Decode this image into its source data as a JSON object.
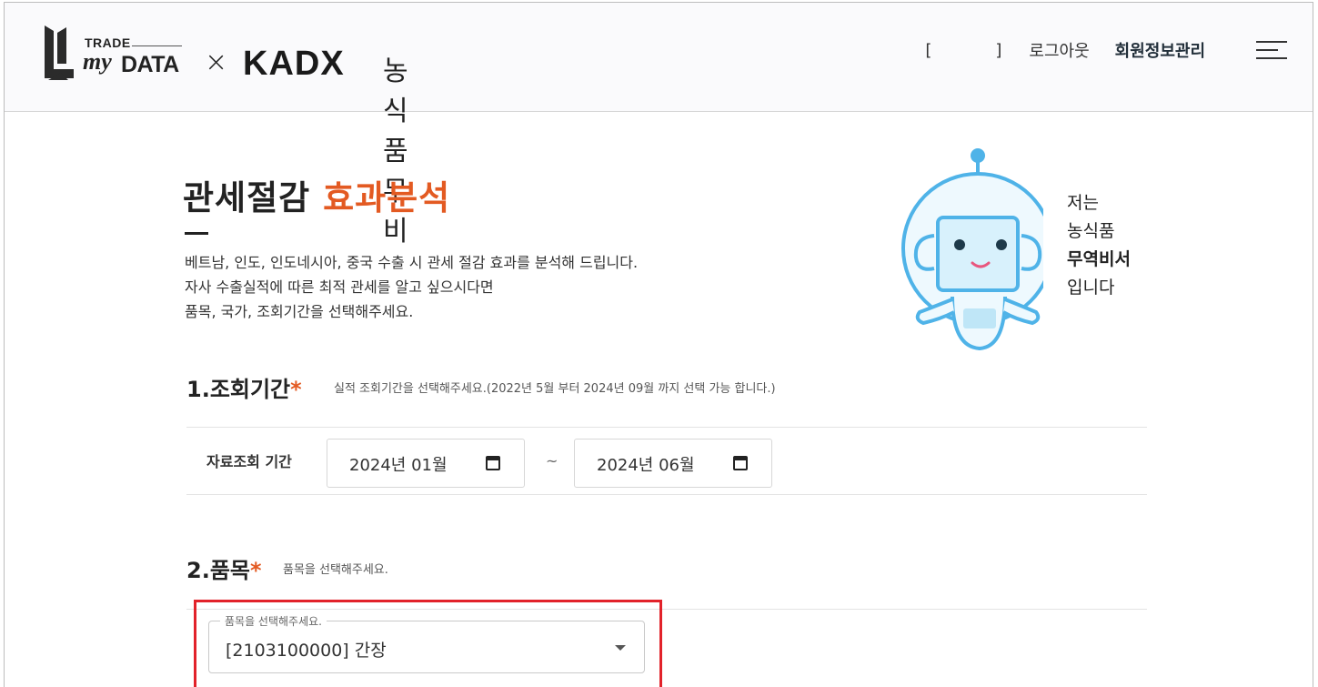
{
  "header": {
    "logo": {
      "trade": "TRADE",
      "my": "my",
      "data": "DATA",
      "x": "×",
      "kadx": "KADX",
      "korean": "농식품무비"
    },
    "nav": {
      "bracket_open": "[",
      "user_name": "",
      "bracket_close": "]",
      "logout": "로그아웃",
      "member_info": "회원정보관리"
    },
    "menu_icon": "hamburger-icon"
  },
  "main": {
    "title_plain": "관세절감",
    "title_accent": "효과분석",
    "description": [
      "베트남, 인도, 인도네시아, 중국 수출 시 관세 절감 효과를 분석해 드립니다.",
      "자사 수출실적에 따른 최적 관세를 알고 싶으시다면",
      "품목, 국가, 조회기간을 선택해주세요."
    ],
    "robot": {
      "line1": "저는",
      "line2": "농식품",
      "line3": "무역비서",
      "line4": "입니다"
    }
  },
  "section1": {
    "title": "1.조회기간",
    "required_mark": "*",
    "hint": "실적 조회기간을 선택해주세요.(2022년 5월 부터 2024년 09월 까지 선택 가능 합니다.)",
    "row_label": "자료조회 기간",
    "start_date": "2024년 01월",
    "separator": "~",
    "end_date": "2024년 06월"
  },
  "section2": {
    "title": "2.품목",
    "required_mark": "*",
    "hint": "품목을 선택해주세요.",
    "select_legend": "품목을 선택해주세요.",
    "select_value": "[2103100000] 간장"
  },
  "colors": {
    "accent": "#e35a22",
    "highlight": "#e2222a",
    "robot_blue": "#4fb3e8",
    "robot_face": "#d8f1fc"
  }
}
